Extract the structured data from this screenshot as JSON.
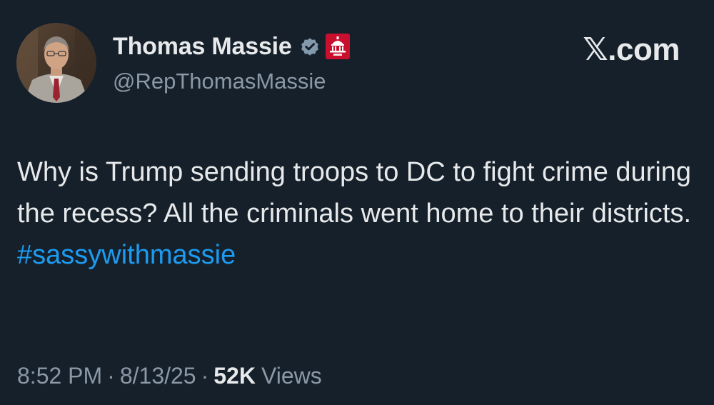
{
  "colors": {
    "background": "#15202b",
    "text_primary": "#e7e9ea",
    "text_secondary": "#8b98a5",
    "link": "#1d9bf0",
    "verified_badge": "#829aab",
    "gov_badge": "#c8102e"
  },
  "author": {
    "display_name": "Thomas Massie",
    "handle": "@RepThomasMassie",
    "verified_icon": "verified-badge-icon",
    "affiliation_icon": "capitol-gop-badge-icon"
  },
  "site_logo": "𝕏.com",
  "tweet": {
    "text": "Why is Trump sending troops to DC to fight crime during the recess? All the criminals went home to their districts.",
    "hashtag": "#sassywithmassie"
  },
  "meta": {
    "time": "8:52 PM",
    "separator": "·",
    "date": "8/13/25",
    "views_count": "52K",
    "views_label": "Views"
  }
}
